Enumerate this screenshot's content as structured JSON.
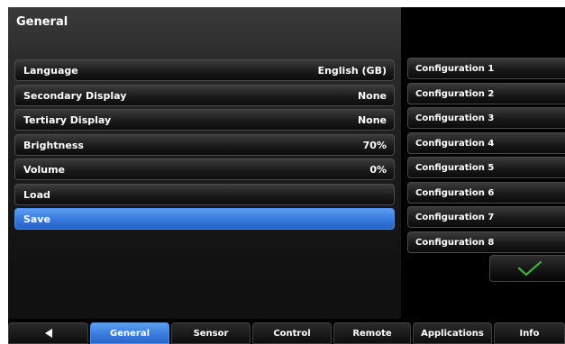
{
  "panel": {
    "title": "General"
  },
  "settings": [
    {
      "label": "Language",
      "value": "English (GB)"
    },
    {
      "label": "Secondary Display",
      "value": "None"
    },
    {
      "label": "Tertiary Display",
      "value": "None"
    },
    {
      "label": "Brightness",
      "value": "70%"
    },
    {
      "label": "Volume",
      "value": "0%"
    },
    {
      "label": "Load",
      "value": ""
    },
    {
      "label": "Save",
      "value": ""
    }
  ],
  "selected_setting": "Save",
  "configurations": [
    "Configuration 1",
    "Configuration 2",
    "Configuration 3",
    "Configuration 4",
    "Configuration 5",
    "Configuration 6",
    "Configuration 7",
    "Configuration 8"
  ],
  "tabs": [
    {
      "label": "",
      "icon": "back-arrow-icon"
    },
    {
      "label": "General"
    },
    {
      "label": "Sensor"
    },
    {
      "label": "Control"
    },
    {
      "label": "Remote"
    },
    {
      "label": "Applications"
    },
    {
      "label": "Info"
    }
  ],
  "active_tab": "General",
  "colors": {
    "accent_blue": "#3a7be0",
    "checkmark_green": "#3fae3a",
    "background": "#000000"
  },
  "icons": {
    "back": "back-arrow-icon",
    "confirm": "checkmark-icon"
  }
}
